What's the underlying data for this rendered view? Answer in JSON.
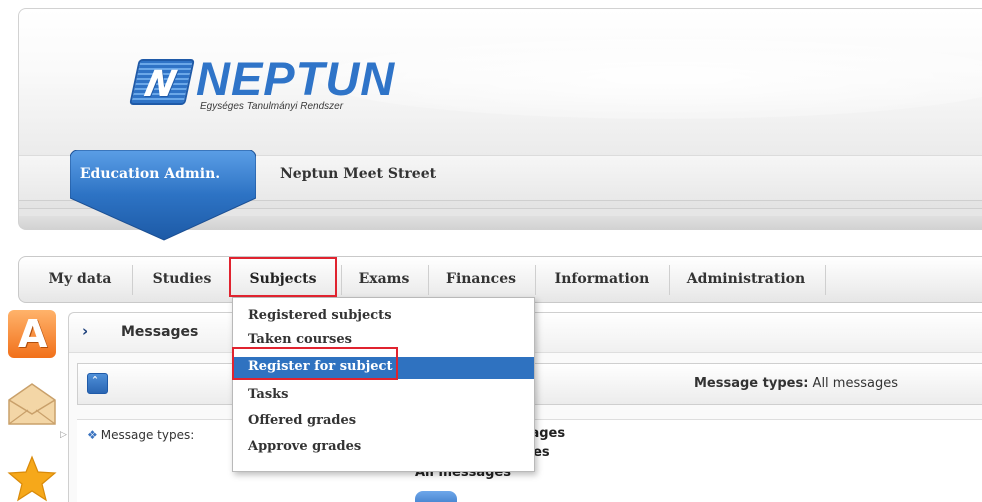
{
  "header": {
    "logo_text": "NEPTUN",
    "logo_subtitle": "Egységes Tanulmányi Rendszer",
    "logo_mark": "N",
    "tabs": [
      {
        "label": "Education Admin.",
        "active": true
      },
      {
        "label": "Neptun Meet Street",
        "active": false
      }
    ]
  },
  "nav": {
    "items": [
      {
        "label": "My data"
      },
      {
        "label": "Studies"
      },
      {
        "label": "Subjects",
        "highlighted": true
      },
      {
        "label": "Exams"
      },
      {
        "label": "Finances"
      },
      {
        "label": "Information"
      },
      {
        "label": "Administration"
      }
    ]
  },
  "subjects_menu": {
    "items": [
      {
        "label": "Registered subjects"
      },
      {
        "label": "Taken courses"
      },
      {
        "label": "Register for subject",
        "active": true,
        "highlighted": true
      },
      {
        "label": "Tasks"
      },
      {
        "label": "Offered grades"
      },
      {
        "label": "Approve grades"
      }
    ]
  },
  "sidebar": {
    "icons": [
      "a-letter-icon",
      "envelope-icon",
      "star-icon"
    ],
    "a_icon_letter": "A"
  },
  "messages": {
    "title": "Messages",
    "collapse_glyph": "ˆ",
    "message_types_label": "Message types:",
    "message_types_value": "All messages",
    "filter_label": "Message types:",
    "options": [
      "ssages",
      "ages",
      "All messages"
    ]
  },
  "colors": {
    "brand_blue": "#2f74c8",
    "menu_active": "#2f72c0",
    "highlight_red": "#e0232f"
  }
}
